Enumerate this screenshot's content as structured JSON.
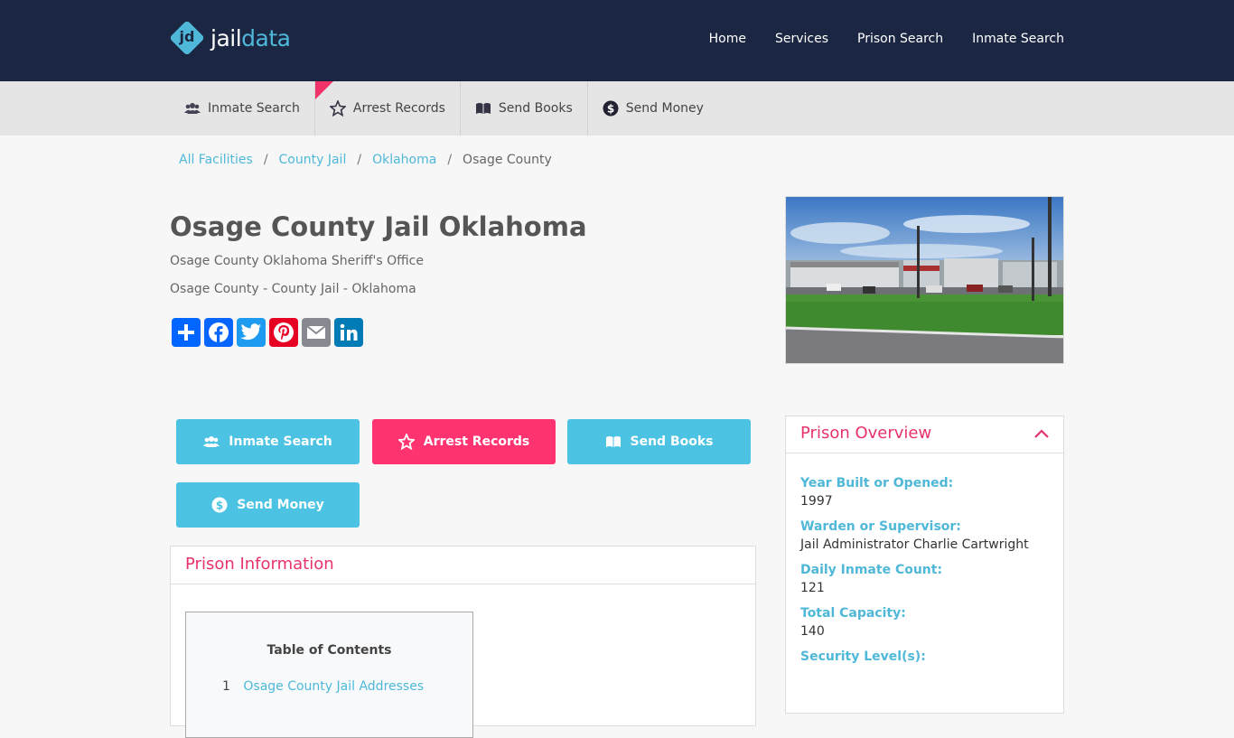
{
  "brand": {
    "logo_mark": "jd",
    "name_part1": "jail",
    "name_part2": "data"
  },
  "topnav": [
    "Home",
    "Services",
    "Prison Search",
    "Inmate Search"
  ],
  "subnav": [
    {
      "label": "Inmate Search",
      "icon": "users-icon"
    },
    {
      "label": "Arrest Records",
      "icon": "star-badge-icon"
    },
    {
      "label": "Send Books",
      "icon": "book-icon"
    },
    {
      "label": "Send Money",
      "icon": "dollar-icon"
    }
  ],
  "breadcrumb": {
    "items": [
      "All Facilities",
      "County Jail",
      "Oklahoma"
    ],
    "current": "Osage County",
    "separator": "/"
  },
  "page": {
    "title": "Osage County Jail Oklahoma",
    "subtitle1": "Osage County Oklahoma Sheriff's Office",
    "subtitle2": "Osage County - County Jail - Oklahoma"
  },
  "share": [
    "share-plus-icon",
    "facebook-icon",
    "twitter-icon",
    "pinterest-icon",
    "email-icon",
    "linkedin-icon"
  ],
  "actions": [
    {
      "label": "Inmate Search",
      "color": "#4cc3e3"
    },
    {
      "label": "Arrest Records",
      "color": "#ff3370"
    },
    {
      "label": "Send Books",
      "color": "#4cc3e3"
    },
    {
      "label": "Send Money",
      "color": "#4cc3e3"
    }
  ],
  "info": {
    "heading": "Prison Information",
    "toc_title": "Table of Contents",
    "toc_items": [
      {
        "num": "1",
        "label": "Osage County Jail Addresses"
      }
    ]
  },
  "overview": {
    "heading": "Prison Overview",
    "fields": [
      {
        "label": "Year Built or Opened:",
        "value": "1997"
      },
      {
        "label": "Warden or Supervisor:",
        "value": "Jail Administrator Charlie Cartwright"
      },
      {
        "label": "Daily Inmate Count:",
        "value": "121"
      },
      {
        "label": "Total Capacity:",
        "value": "140"
      },
      {
        "label": "Security Level(s):",
        "value": ""
      }
    ]
  },
  "colors": {
    "header": "#1a2642",
    "accent_blue": "#4fb8d9",
    "accent_pink": "#e8336a"
  }
}
